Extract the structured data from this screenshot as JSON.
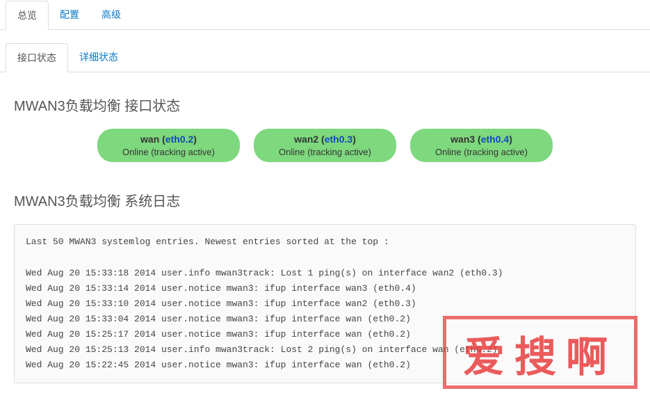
{
  "tabs_top": [
    {
      "label": "总览",
      "active": true
    },
    {
      "label": "配置",
      "active": false
    },
    {
      "label": "高级",
      "active": false
    }
  ],
  "tabs_sub": [
    {
      "label": "接口状态",
      "active": true
    },
    {
      "label": "详细状态",
      "active": false
    }
  ],
  "section_interface_title": "MWAN3负载均衡 接口状态",
  "interfaces": [
    {
      "name": "wan",
      "iface": "eth0.2",
      "state": "Online (tracking active)"
    },
    {
      "name": "wan2",
      "iface": "eth0.3",
      "state": "Online (tracking active)"
    },
    {
      "name": "wan3",
      "iface": "eth0.4",
      "state": "Online (tracking active)"
    }
  ],
  "section_log_title": "MWAN3负载均衡 系统日志",
  "log_header": "Last 50 MWAN3 systemlog entries. Newest entries sorted at the top :",
  "log_lines": [
    "Wed Aug 20 15:33:18 2014 user.info mwan3track: Lost 1 ping(s) on interface wan2 (eth0.3)",
    "Wed Aug 20 15:33:14 2014 user.notice mwan3: ifup interface wan3 (eth0.4)",
    "Wed Aug 20 15:33:10 2014 user.notice mwan3: ifup interface wan2 (eth0.3)",
    "Wed Aug 20 15:33:04 2014 user.notice mwan3: ifup interface wan (eth0.2)",
    "Wed Aug 20 15:25:17 2014 user.notice mwan3: ifup interface wan (eth0.2)",
    "Wed Aug 20 15:25:13 2014 user.info mwan3track: Lost 2 ping(s) on interface wan (eth0.2)",
    "Wed Aug 20 15:22:45 2014 user.notice mwan3: ifup interface wan (eth0.2)"
  ],
  "stamp_text": "爱搜啊"
}
